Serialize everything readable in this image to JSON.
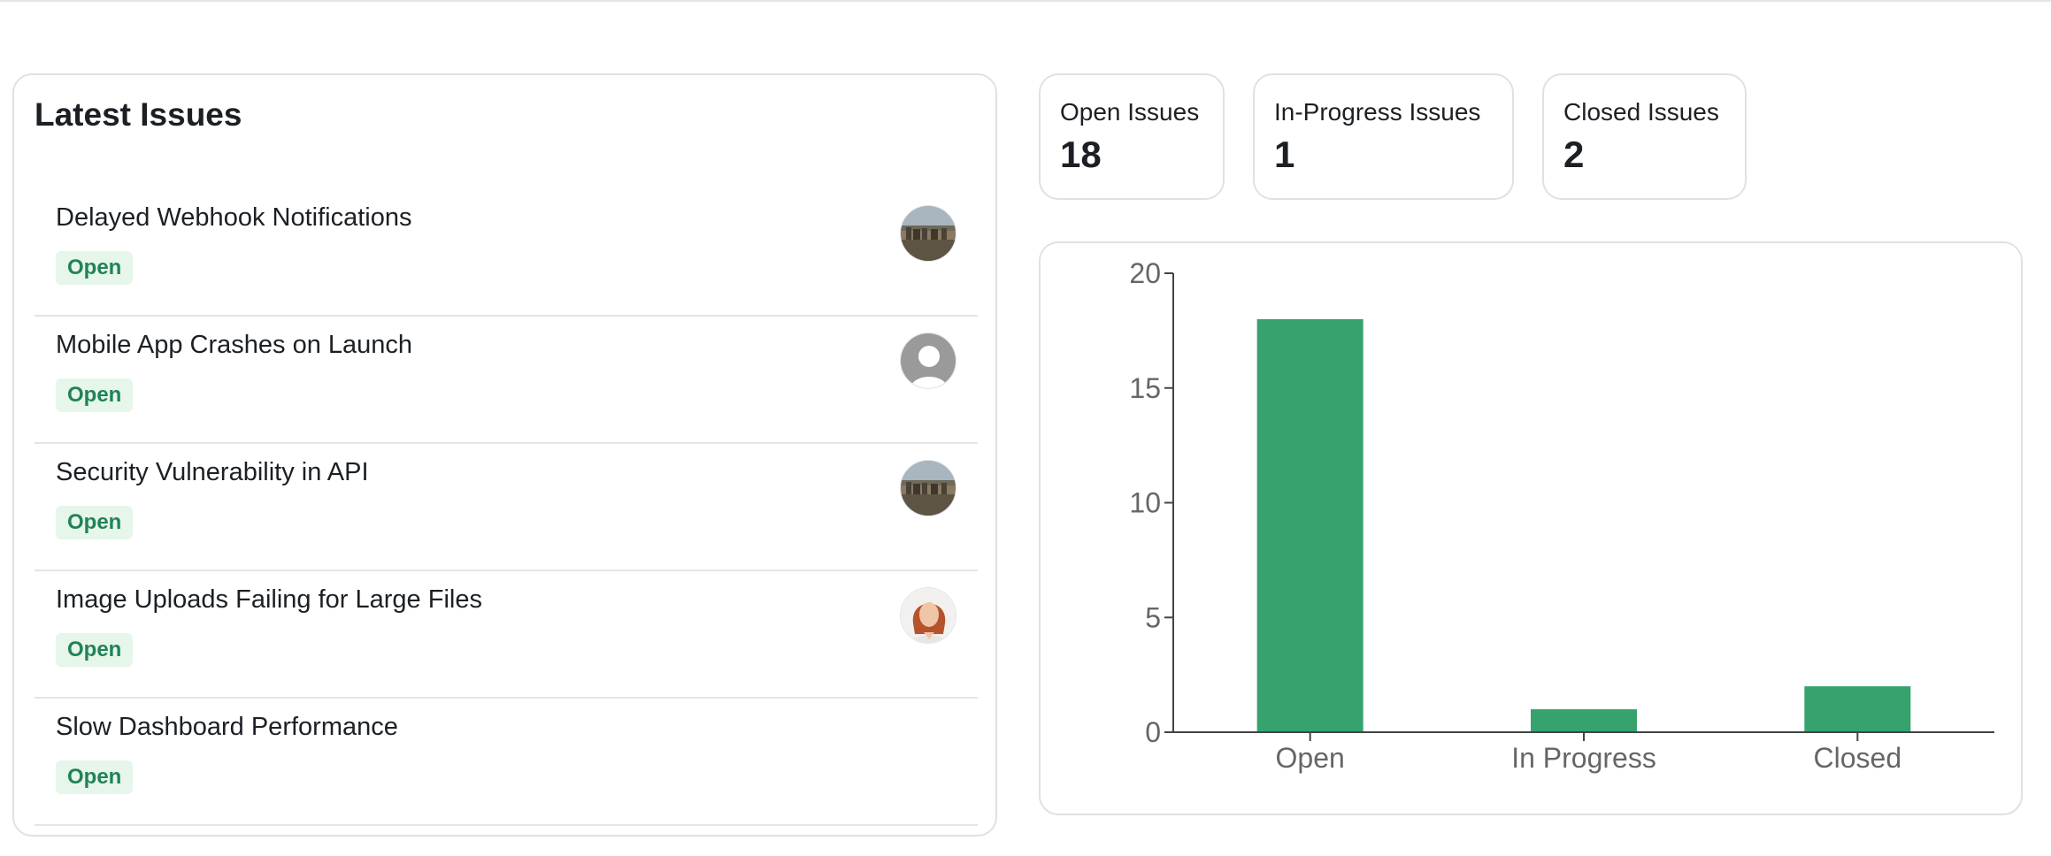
{
  "latest_issues": {
    "title": "Latest Issues",
    "items": [
      {
        "title": "Delayed Webhook Notifications",
        "status": "Open",
        "avatar": "landscape-photo-avatar"
      },
      {
        "title": "Mobile App Crashes on Launch",
        "status": "Open",
        "avatar": "default-user-avatar"
      },
      {
        "title": "Security Vulnerability in API",
        "status": "Open",
        "avatar": "landscape-photo-avatar"
      },
      {
        "title": "Image Uploads Failing for Large Files",
        "status": "Open",
        "avatar": "woman-photo-avatar"
      },
      {
        "title": "Slow Dashboard Performance",
        "status": "Open",
        "avatar": null
      }
    ]
  },
  "stats": {
    "open": {
      "label": "Open Issues",
      "value": "18"
    },
    "in_progress": {
      "label": "In-Progress Issues",
      "value": "1"
    },
    "closed": {
      "label": "Closed Issues",
      "value": "2"
    }
  },
  "colors": {
    "accent_green": "#36a36f",
    "badge_bg": "#e6f6eb",
    "badge_text": "#218358"
  },
  "chart_data": {
    "type": "bar",
    "categories": [
      "Open",
      "In Progress",
      "Closed"
    ],
    "values": [
      18,
      1,
      2
    ],
    "yticks": [
      0,
      5,
      10,
      15,
      20
    ],
    "ylim": [
      0,
      20
    ],
    "xlabel": "",
    "ylabel": "",
    "title": "",
    "grid": false,
    "color": "#36a36f"
  }
}
